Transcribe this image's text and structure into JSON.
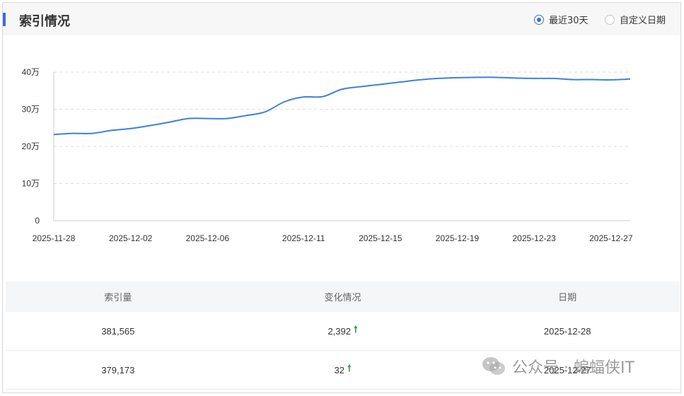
{
  "header": {
    "title": "索引情况",
    "range_options": [
      {
        "label": "最近30天",
        "selected": true
      },
      {
        "label": "自定义日期",
        "selected": false
      }
    ]
  },
  "chart_data": {
    "type": "line",
    "ylim": [
      0,
      400000
    ],
    "y_ticks": [
      "0",
      "10万",
      "20万",
      "30万",
      "40万"
    ],
    "x_ticks": [
      "2025-11-28",
      "2025-12-02",
      "2025-12-06",
      "2025-12-11",
      "2025-12-15",
      "2025-12-19",
      "2025-12-23",
      "2025-12-27"
    ],
    "line_color": "#3f7fe0",
    "grid": true,
    "series": [
      {
        "x": [
          "2025-11-28",
          "2025-11-29",
          "2025-11-30",
          "2025-12-01",
          "2025-12-02",
          "2025-12-03",
          "2025-12-04",
          "2025-12-05",
          "2025-12-06",
          "2025-12-07",
          "2025-12-08",
          "2025-12-09",
          "2025-12-10",
          "2025-12-11",
          "2025-12-12",
          "2025-12-13",
          "2025-12-14",
          "2025-12-15",
          "2025-12-16",
          "2025-12-17",
          "2025-12-18",
          "2025-12-19",
          "2025-12-20",
          "2025-12-21",
          "2025-12-22",
          "2025-12-23",
          "2025-12-24",
          "2025-12-25",
          "2025-12-26",
          "2025-12-27",
          "2025-12-28"
        ],
        "values": [
          232000,
          235000,
          235000,
          243000,
          248000,
          256000,
          265000,
          275000,
          275000,
          275000,
          283000,
          293000,
          320000,
          333000,
          334000,
          354000,
          361000,
          367000,
          373000,
          379000,
          383000,
          385000,
          386000,
          386000,
          384000,
          383000,
          383000,
          380000,
          380000,
          379173,
          381565
        ]
      }
    ]
  },
  "table": {
    "headers": [
      "索引量",
      "变化情况",
      "日期"
    ],
    "rows": [
      {
        "count": "381,565",
        "change": "2,392",
        "date": "2025-12-28"
      },
      {
        "count": "379,173",
        "change": "32",
        "date": "2025-12-27"
      }
    ],
    "up_arrow": "🠕"
  },
  "watermark": {
    "text": "公众号 · 蝙蝠侠IT",
    "icon": "wechat-icon"
  }
}
